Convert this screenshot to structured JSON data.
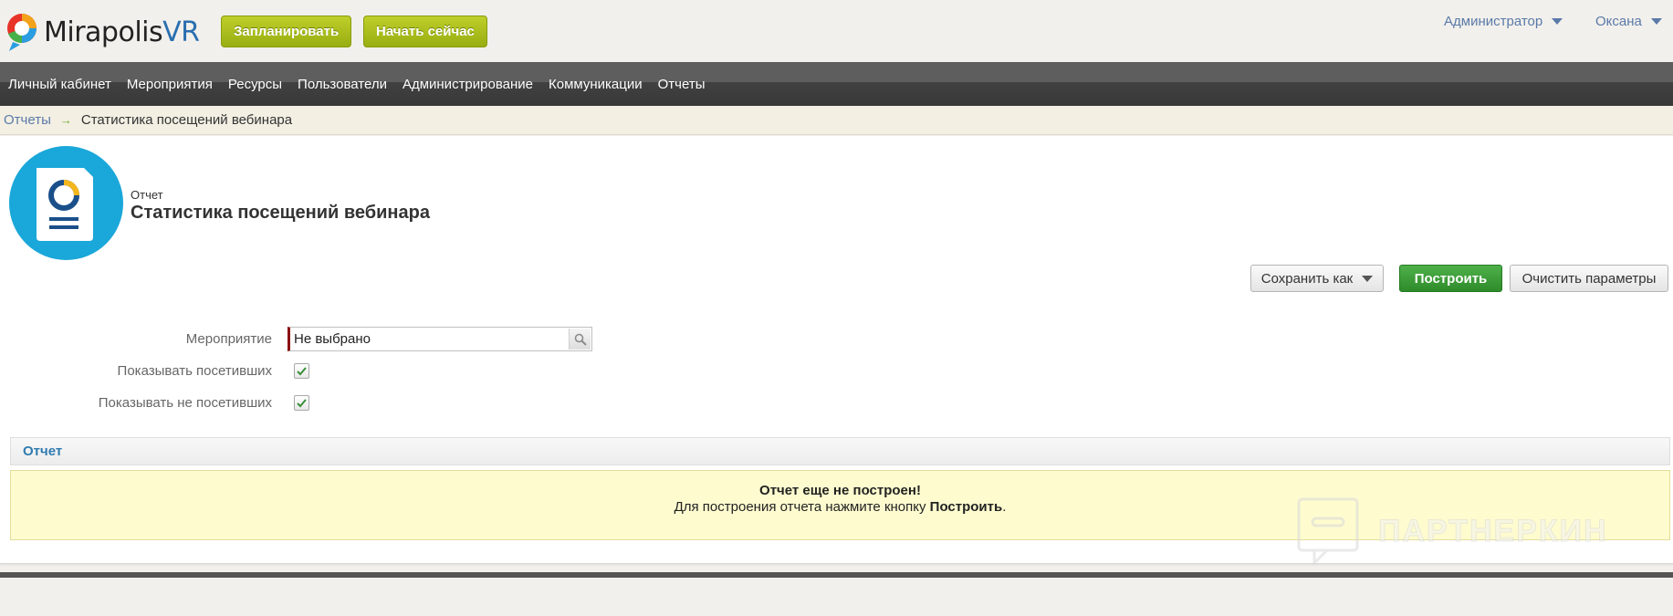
{
  "header": {
    "logo_main": "Mirapolis",
    "logo_vr": "VR",
    "plan_button": "Запланировать",
    "start_button": "Начать сейчас",
    "user_menu_admin": "Администратор",
    "user_menu_user": "Оксана"
  },
  "nav": {
    "items": [
      "Личный кабинет",
      "Мероприятия",
      "Ресурсы",
      "Пользователи",
      "Администрирование",
      "Коммуникации",
      "Отчеты"
    ]
  },
  "breadcrumb": {
    "parent": "Отчеты",
    "separator": "→",
    "current": "Статистика посещений вебинара"
  },
  "page": {
    "subtitle": "Отчет",
    "title": "Статистика посещений вебинара"
  },
  "toolbar": {
    "save_as": "Сохранить как",
    "build": "Построить",
    "clear": "Очистить параметры"
  },
  "form": {
    "event_label": "Мероприятие",
    "event_value": "Не выбрано",
    "show_visited_label": "Показывать посетивших",
    "show_visited_checked": true,
    "show_not_visited_label": "Показывать не посетивших",
    "show_not_visited_checked": true
  },
  "report": {
    "header": "Отчет",
    "empty_title": "Отчет еще не построен!",
    "empty_hint_prefix": "Для построения отчета нажмите кнопку ",
    "empty_hint_button": "Построить",
    "empty_hint_suffix": "."
  },
  "watermark": {
    "text": "ПАРТНЕРКИН"
  },
  "colors": {
    "accent_green": "#2e8b2a",
    "header_button": "#98ae12",
    "link_blue": "#5a7aa8",
    "report_icon_bg": "#1aa7d9",
    "empty_report_bg": "#fefccf"
  }
}
